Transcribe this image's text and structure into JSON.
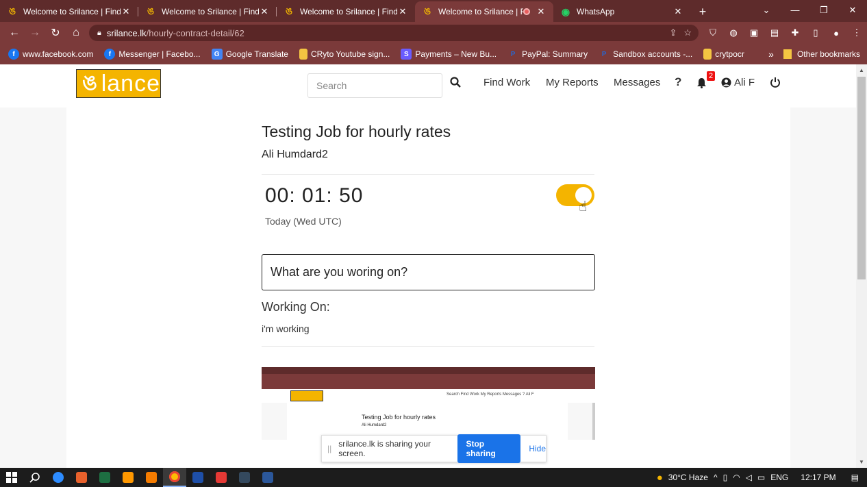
{
  "browser": {
    "tabs": [
      {
        "title": "Welcome to Srilance | Find D",
        "active": false
      },
      {
        "title": "Welcome to Srilance | Find D",
        "active": false
      },
      {
        "title": "Welcome to Srilance | Find D",
        "active": false
      },
      {
        "title": "Welcome to Srilance | Fir",
        "active": true
      },
      {
        "title": "WhatsApp",
        "active": false
      }
    ],
    "url_domain": "srilance.lk",
    "url_path": "/hourly-contract-detail/62",
    "bookmarks": [
      {
        "label": "www.facebook.com",
        "icon": "facebook-icon",
        "color": "#1877f2"
      },
      {
        "label": "Messenger | Facebo...",
        "icon": "facebook-icon",
        "color": "#1877f2"
      },
      {
        "label": "Google Translate",
        "icon": "translate-icon",
        "color": "#4285f4"
      },
      {
        "label": "CRyto Youtube sign...",
        "icon": "folder-icon",
        "color": "#f4c542"
      },
      {
        "label": "Payments – New Bu...",
        "icon": "s-icon",
        "color": "#6a5cff"
      },
      {
        "label": "PayPal: Summary",
        "icon": "paypal-icon",
        "color": "#1f3b8a"
      },
      {
        "label": "Sandbox accounts -...",
        "icon": "paypal-icon",
        "color": "#1f3b8a"
      },
      {
        "label": "crytpocr",
        "icon": "folder-icon",
        "color": "#f4c542"
      }
    ],
    "bookmarks_more": "»",
    "other_bookmarks": "Other bookmarks"
  },
  "site": {
    "logo_text": "lance",
    "search_placeholder": "Search",
    "nav": {
      "find_work": "Find Work",
      "my_reports": "My Reports",
      "messages": "Messages",
      "help": "?",
      "notifications_count": "2",
      "user_name": "Ali F"
    }
  },
  "contract": {
    "title": "Testing Job for hourly rates",
    "client": "Ali Humdard2",
    "timer": "00: 01: 50",
    "timer_caption": "Today (Wed UTC)",
    "tracking_on": true,
    "work_placeholder": "What are you woring on?",
    "working_on_label": "Working On:",
    "working_on_value": "i'm working"
  },
  "screenshot_preview": {
    "title": "Testing Job for hourly rates",
    "client": "Ali Humdard2",
    "nav": "Search   Find Work   My Reports   Messages   ?   Ali F"
  },
  "share_bar": {
    "message": "srilance.lk is sharing your screen.",
    "stop_label": "Stop sharing",
    "hide_label": "Hide"
  },
  "taskbar": {
    "weather": "30°C  Haze",
    "language": "ENG",
    "time": "12:17 PM"
  },
  "colors": {
    "brand": "#f4b400",
    "chrome_frame": "#7b3a3a",
    "share_blue": "#1a73e8"
  }
}
